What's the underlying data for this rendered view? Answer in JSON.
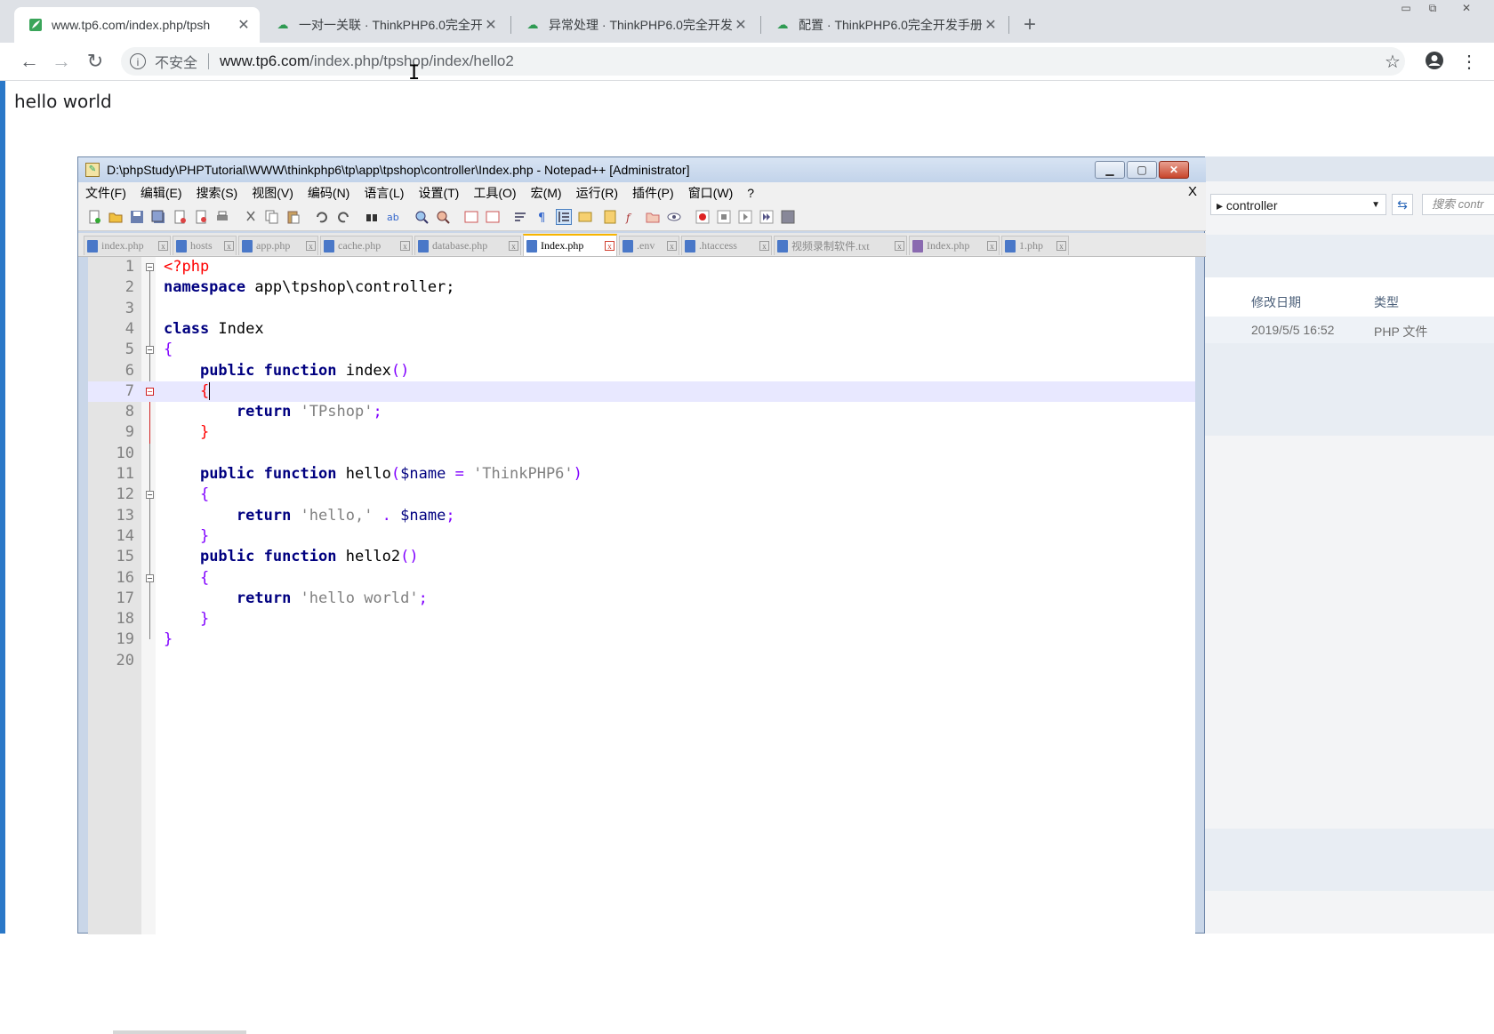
{
  "browser": {
    "tabs": [
      {
        "title": "www.tp6.com/index.php/tpsh",
        "active": true,
        "icon": "thinkphp-leaf-icon"
      },
      {
        "title": "一对一关联 · ThinkPHP6.0完全开",
        "active": false,
        "icon": "kancloud-icon"
      },
      {
        "title": "异常处理 · ThinkPHP6.0完全开发",
        "active": false,
        "icon": "kancloud-icon"
      },
      {
        "title": "配置 · ThinkPHP6.0完全开发手册",
        "active": false,
        "icon": "kancloud-icon"
      }
    ],
    "new_tab": "+",
    "omnibox": {
      "security_label": "不安全",
      "host": "www.tp6.com",
      "path": "/index.php/tpshop/index/hello2"
    },
    "page_text": "hello world"
  },
  "notepad": {
    "title": "D:\\phpStudy\\PHPTutorial\\WWW\\thinkphp6\\tp\\app\\tpshop\\controller\\Index.php - Notepad++ [Administrator]",
    "menu": [
      "文件(F)",
      "编辑(E)",
      "搜索(S)",
      "视图(V)",
      "编码(N)",
      "语言(L)",
      "设置(T)",
      "工具(O)",
      "宏(M)",
      "运行(R)",
      "插件(P)",
      "窗口(W)",
      "?"
    ],
    "menu_close": "X",
    "tabs": [
      {
        "label": "index.php",
        "active": false
      },
      {
        "label": "hosts",
        "active": false
      },
      {
        "label": "app.php",
        "active": false
      },
      {
        "label": "cache.php",
        "active": false
      },
      {
        "label": "database.php",
        "active": false
      },
      {
        "label": "Index.php",
        "active": true
      },
      {
        "label": ".env",
        "active": false
      },
      {
        "label": ".htaccess",
        "active": false
      },
      {
        "label": "视频录制软件.txt",
        "active": false
      },
      {
        "label": "Index.php",
        "active": false
      },
      {
        "label": "1.php",
        "active": false
      }
    ],
    "line_numbers": [
      "1",
      "2",
      "3",
      "4",
      "5",
      "6",
      "7",
      "8",
      "9",
      "10",
      "11",
      "12",
      "13",
      "14",
      "15",
      "16",
      "17",
      "18",
      "19",
      "20"
    ],
    "code": {
      "l1": "<?php",
      "l2_kw": "namespace",
      "l2_rest": " app\\tpshop\\controller;",
      "l4_kw": "class",
      "l4_rest": " Index",
      "l5": "{",
      "l6_kw": "public function",
      "l6_name": " index",
      "l6_paren": "()",
      "l7": "{",
      "l8_kw": "return",
      "l8_str": " 'TPshop'",
      "l8_end": ";",
      "l9": "}",
      "l11_kw": "public function",
      "l11_name": " hello",
      "l11_open": "(",
      "l11_var": "$name",
      "l11_eq": " = ",
      "l11_str": "'ThinkPHP6'",
      "l11_close": ")",
      "l12": "{",
      "l13_kw": "return",
      "l13_str": " 'hello,'",
      "l13_dot": " . ",
      "l13_var": "$name",
      "l13_end": ";",
      "l14": "}",
      "l15_kw": "public function",
      "l15_name": " hello2",
      "l15_paren": "()",
      "l16": "{",
      "l17_kw": "return",
      "l17_str": " 'hello world'",
      "l17_end": ";",
      "l18": "}",
      "l19": "}"
    }
  },
  "explorer": {
    "address": "controller",
    "search_placeholder": "搜索 contr",
    "columns": {
      "modified": "修改日期",
      "type": "类型"
    },
    "row": {
      "modified": "2019/5/5 16:52",
      "type": "PHP 文件"
    }
  }
}
